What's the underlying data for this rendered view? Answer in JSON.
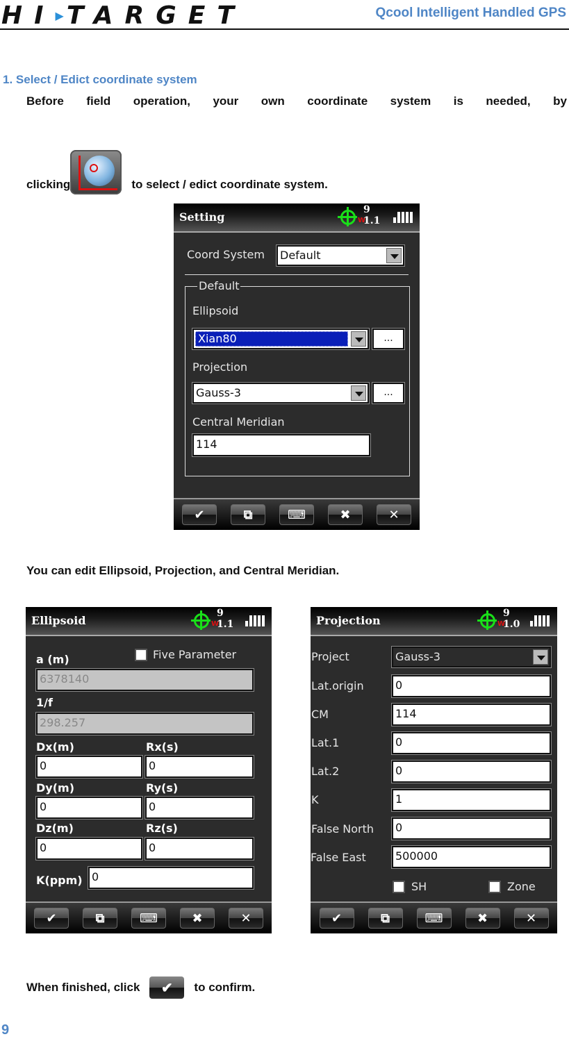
{
  "header": {
    "logo_text": "HI",
    "logo_text_2": "TARGET",
    "doc_title": "Qcool Intelligent Handled GPS"
  },
  "section": {
    "number_title": "1.  Select / Edict coordinate system",
    "para1_words": [
      "Before",
      "field",
      "operation,",
      "your",
      "own",
      "coordinate",
      "system",
      "is",
      "needed,",
      "by"
    ],
    "para1_line2_before": "clicking",
    "para1_line2_after": "to select / edict coordinate system.",
    "para2": "You can edit Ellipsoid, Projection, and Central Meridian.",
    "para3_before": "When finished, click",
    "para3_after": "to confirm."
  },
  "status": {
    "satellites_a": "9",
    "hdop_a": "1.1",
    "satellites_b": "9",
    "hdop_b": "1.0",
    "warn": "W"
  },
  "toolbar": [
    "✔",
    "⧉",
    "⌨",
    "✖",
    "✕"
  ],
  "setting_screen": {
    "title": "Setting",
    "coord_system_label": "Coord System",
    "coord_system_value": "Default",
    "group_title": "Default",
    "ellipsoid_label": "Ellipsoid",
    "ellipsoid_value": "Xian80",
    "projection_label": "Projection",
    "projection_value": "Gauss-3",
    "more_button": "...",
    "central_meridian_label": "Central Meridian",
    "central_meridian_value": "114"
  },
  "ellipsoid_screen": {
    "title": "Ellipsoid",
    "five_parameter_label": "Five Parameter",
    "a_label": "a (m)",
    "a_value": "6378140",
    "f_label": "1/f",
    "f_value": "298.257",
    "dx_label": "Dx(m)",
    "dx_value": "0",
    "rx_label": "Rx(s)",
    "rx_value": "0",
    "dy_label": "Dy(m)",
    "dy_value": "0",
    "ry_label": "Ry(s)",
    "ry_value": "0",
    "dz_label": "Dz(m)",
    "dz_value": "0",
    "rz_label": "Rz(s)",
    "rz_value": "0",
    "k_label": "K(ppm)",
    "k_value": "0"
  },
  "projection_screen": {
    "title": "Projection",
    "rows": [
      {
        "label": "Project",
        "value": "Gauss-3"
      },
      {
        "label": "Lat.origin",
        "value": "0"
      },
      {
        "label": "CM",
        "value": "114"
      },
      {
        "label": "Lat.1",
        "value": "0"
      },
      {
        "label": "Lat.2",
        "value": "0"
      },
      {
        "label": "K",
        "value": "1"
      },
      {
        "label": "False North",
        "value": "0"
      },
      {
        "label": "False East",
        "value": "500000"
      }
    ],
    "sh_label": "SH",
    "zone_label": "Zone"
  },
  "footer": {
    "page_number": "9"
  }
}
